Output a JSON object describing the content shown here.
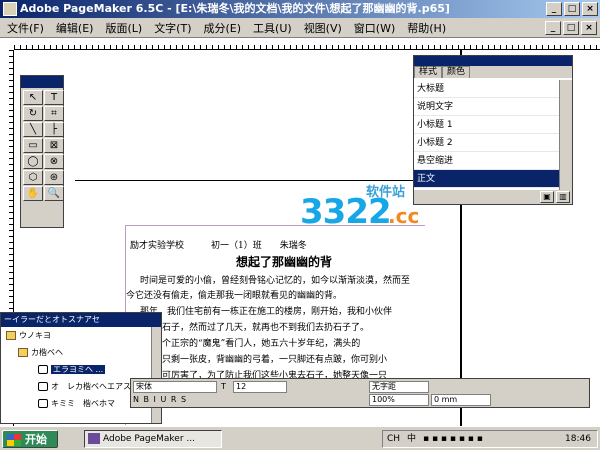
{
  "window": {
    "title": "Adobe PageMaker 6.5C - [E:\\朱瑞冬\\我的文档\\我的文件\\想起了那幽幽的背.p65]"
  },
  "menubar": {
    "items": [
      "文件(F)",
      "编辑(E)",
      "版面(L)",
      "文字(T)",
      "成分(E)",
      "工具(U)",
      "视图(V)",
      "窗口(W)",
      "帮助(H)"
    ]
  },
  "styles_panel": {
    "tabs": [
      "样式",
      "颜色"
    ],
    "items": [
      "大标题",
      "说明文字",
      "小标题 1",
      "小标题 2",
      "悬空缩进",
      "正文"
    ],
    "selected": "正文"
  },
  "watermark": {
    "main": "3322",
    "suffix": ".cc",
    "label": "软件站"
  },
  "document": {
    "header": "励才实验学校　　　初一（1）班　　朱瑞冬",
    "title": "想起了那幽幽的背",
    "paragraphs": [
      "时间是可爱的小偷，曾经刻骨铭心记忆的，如今以渐渐淡漠，然而至",
      "今它还没有偷走，偷走那我一闭眼就看见的幽幽的背。",
      "那年，我们住宅前有一栋正在施工的楼房，刚开始，我和小伙伴",
      "工地上扔石子，然而过了几天，就再也不到我们去扔石子了。",
      "是来了一个正宗的“魔鬼”看门人，她五六十岁年纪，满头的",
      "身干瘪的只剩一张皮，背幽幽的弓着，一只脚还有点跛，你可别小",
      "她的眼睛可厉害了，为了防止我们这些小鬼去石子，她整天像一只"
    ]
  },
  "library_panel": {
    "title": "ーイラーだとオトスナアセ",
    "rows": [
      "ウノキヨ",
      "カ楷ベヘ",
      "エラヨミヘ ...",
      "オ　レカ楷ベヘエアスモ ...",
      "キミミ　楷ベホマ"
    ]
  },
  "control_palette": {
    "font": "宋体",
    "size": "12",
    "leading": "无字距",
    "scale": "100%",
    "indent": "0 mm"
  },
  "taskbar": {
    "start": "开始",
    "task": "Adobe PageMaker ...",
    "tray_lang": "CH",
    "tray_ime": "中",
    "time": "18:46"
  }
}
